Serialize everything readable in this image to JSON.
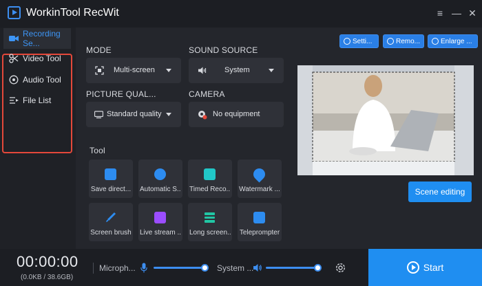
{
  "app": {
    "title": "WorkinTool RecWit"
  },
  "window_controls": {
    "menu": "≡",
    "minimize": "—",
    "close": "✕"
  },
  "sidebar": {
    "items": [
      {
        "label": "Recording Se...",
        "icon": "video-camera-icon",
        "active": true
      },
      {
        "label": "Video Tool",
        "icon": "scissors-icon",
        "active": false
      },
      {
        "label": "Audio Tool",
        "icon": "audio-disc-icon",
        "active": false
      },
      {
        "label": "File List",
        "icon": "list-icon",
        "active": false
      }
    ]
  },
  "toolbar": {
    "settings_label": "Setti...",
    "remove_label": "Remo...",
    "enlarge_label": "Enlarge ..."
  },
  "mode": {
    "label": "MODE",
    "value": "Multi-screen",
    "icon": "multi-screen-icon"
  },
  "sound_source": {
    "label": "SOUND SOURCE",
    "value": "System",
    "icon": "speaker-icon"
  },
  "picture_quality": {
    "label": "PICTURE QUAL...",
    "value": "Standard quality",
    "icon": "monitor-icon"
  },
  "camera": {
    "label": "CAMERA",
    "value": "No equipment",
    "icon": "webcam-icon"
  },
  "tools": {
    "label": "Tool",
    "items": [
      {
        "label": "Save direct...",
        "icon": "save-folder-icon",
        "color": "#2d8cf0"
      },
      {
        "label": "Automatic S...",
        "icon": "auto-stop-icon",
        "color": "#2d8cf0"
      },
      {
        "label": "Timed Reco...",
        "icon": "timed-record-icon",
        "color": "#21c7c7"
      },
      {
        "label": "Watermark ...",
        "icon": "watermark-drop-icon",
        "color": "#2d8cf0"
      },
      {
        "label": "Screen brush",
        "icon": "brush-icon",
        "color": "#2d8cf0"
      },
      {
        "label": "Live stream ...",
        "icon": "tv-icon",
        "color": "#9b4dff"
      },
      {
        "label": "Long screen...",
        "icon": "long-screenshot-icon",
        "color": "#21c7a5"
      },
      {
        "label": "Teleprompter",
        "icon": "teleprompter-icon",
        "color": "#2d8cf0"
      }
    ]
  },
  "scene": {
    "button_label": "Scene editing"
  },
  "bottom": {
    "timer": "00:00:00",
    "size": "(0.0KB / 38.6GB)",
    "microphone_label": "Microph...",
    "system_label": "System ...",
    "start_label": "Start",
    "microphone_level": 1.0,
    "system_level": 1.0
  },
  "colors": {
    "accent": "#1f8ef1",
    "highlight": "#e5483a"
  }
}
